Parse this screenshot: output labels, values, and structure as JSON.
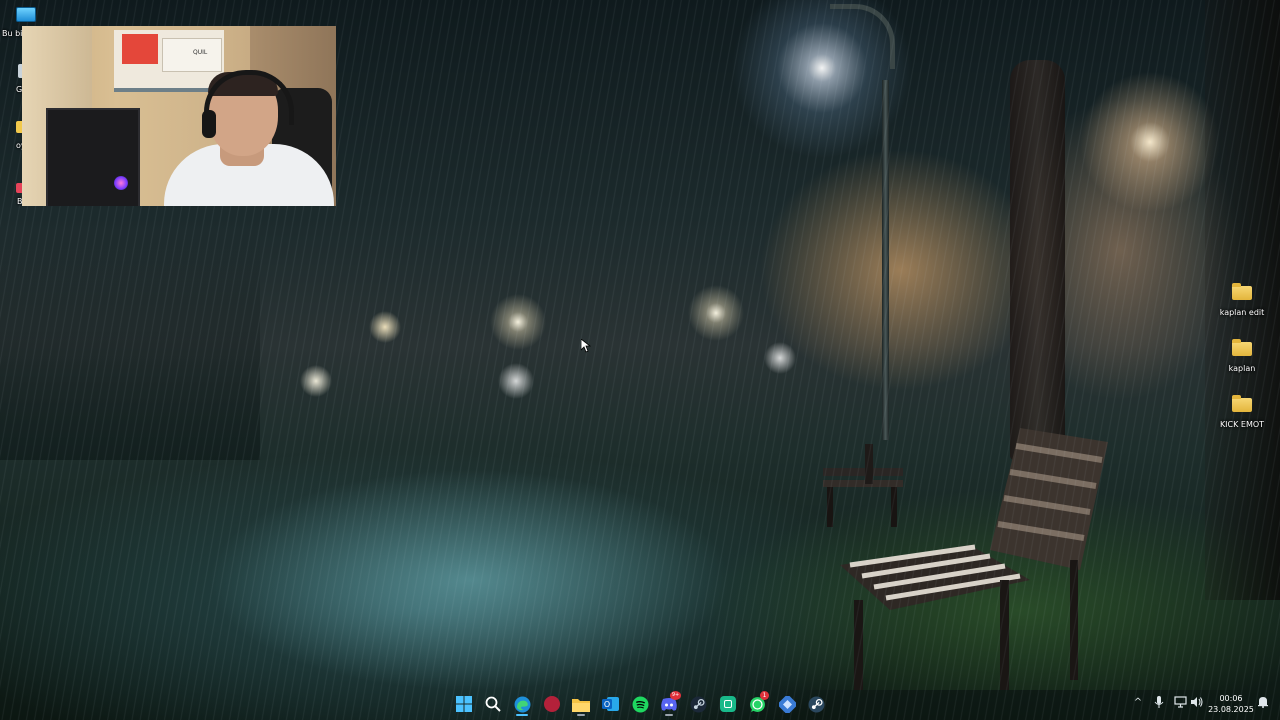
{
  "desktop": {
    "left_icons": [
      {
        "label": "Bu bil",
        "icon": "this-pc-icon"
      },
      {
        "label": "G Dön",
        "icon": "recycle-bin-icon"
      },
      {
        "label": "oy",
        "icon": "shortcut-icon"
      },
      {
        "label": "B",
        "icon": "app-shortcut-icon"
      }
    ],
    "right_icons": [
      {
        "label": "kaplan edit",
        "icon": "folder-icon"
      },
      {
        "label": "kaplan",
        "icon": "folder-icon"
      },
      {
        "label": "KICK EMOT",
        "icon": "folder-icon"
      }
    ],
    "colors": {
      "folder": "#f0c75a",
      "taskbar_bg": "transparent"
    }
  },
  "webcam": {
    "shelf_label": "QUIL"
  },
  "taskbar": {
    "apps": [
      {
        "name": "start",
        "icon": "windows-start-icon"
      },
      {
        "name": "search",
        "icon": "search-icon"
      },
      {
        "name": "edge",
        "icon": "edge-browser-icon"
      },
      {
        "name": "app-red",
        "icon": "red-app-icon"
      },
      {
        "name": "file-explorer",
        "icon": "folder-icon"
      },
      {
        "name": "outlook",
        "icon": "outlook-icon"
      },
      {
        "name": "spotify",
        "icon": "spotify-icon"
      },
      {
        "name": "discord",
        "icon": "discord-icon",
        "badge": "9+"
      },
      {
        "name": "steam",
        "icon": "steam-icon"
      },
      {
        "name": "app-green",
        "icon": "green-app-icon"
      },
      {
        "name": "whatsapp",
        "icon": "whatsapp-icon",
        "badge": "1"
      },
      {
        "name": "app-tool",
        "icon": "tool-app-icon"
      },
      {
        "name": "steam-2",
        "icon": "steam-icon"
      }
    ],
    "tray": {
      "time": "00:06",
      "date": "23.08.2025"
    }
  }
}
